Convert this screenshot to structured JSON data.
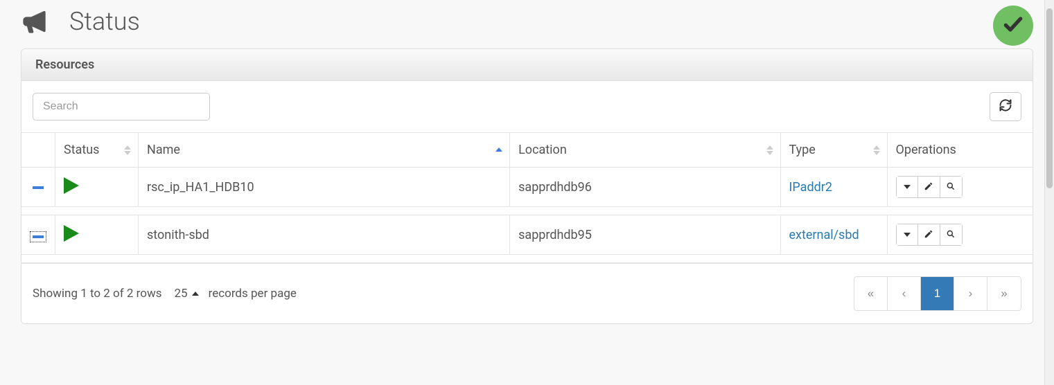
{
  "title": "Status",
  "panel_title": "Resources",
  "search": {
    "placeholder": "Search",
    "value": ""
  },
  "columns": {
    "status": "Status",
    "name": "Name",
    "location": "Location",
    "type": "Type",
    "operations": "Operations"
  },
  "rows": [
    {
      "name": "rsc_ip_HA1_HDB10",
      "location": "sapprdhdb96",
      "type": "IPaddr2"
    },
    {
      "name": "stonith-sbd",
      "location": "sapprdhdb95",
      "type": "external/sbd"
    }
  ],
  "footer": {
    "summary": "Showing 1 to 2 of 2 rows",
    "page_size": "25",
    "records_label": "records per page"
  },
  "pagination": {
    "first": "«",
    "prev": "‹",
    "current": "1",
    "next": "›",
    "last": "»"
  }
}
